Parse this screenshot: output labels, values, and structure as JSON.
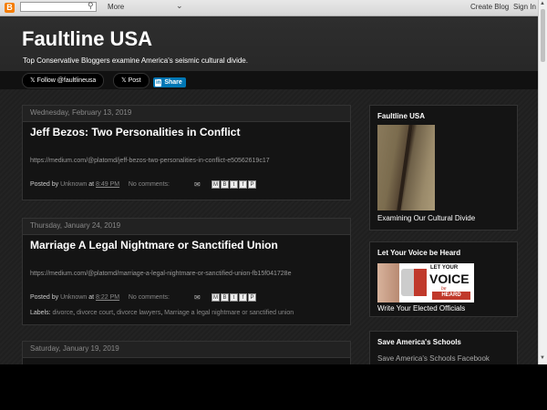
{
  "navbar": {
    "logo_letter": "B",
    "search_icon": "search-icon",
    "more_label": "More",
    "create_blog": "Create Blog",
    "sign_in": "Sign In"
  },
  "header": {
    "title": "Faultline USA",
    "description": "Top Conservative Bloggers examine America's seismic cultural divide.",
    "follow_label": "Follow @faultlineusa",
    "post_label": "Post",
    "share_label": "Share",
    "linkedin_mark": "in"
  },
  "posts": [
    {
      "date": "Wednesday, February 13, 2019",
      "title": "Jeff Bezos: Two Personalities in Conflict",
      "url": "https://medium.com/@platomd/jeff-bezos-two-personalities-in-conflict-e50562619c17",
      "posted_by_label": "Posted by",
      "author": "Unknown",
      "at_label": "at",
      "time": "8:49 PM",
      "comments": "No comments:"
    },
    {
      "date": "Thursday, January 24, 2019",
      "title": "Marriage A Legal Nightmare or Sanctified Union",
      "url": "https://medium.com/@platomd/marriage-a-legal-nightmare-or-sanctified-union-fb15f041728e",
      "posted_by_label": "Posted by",
      "author": "Unknown",
      "at_label": "at",
      "time": "8:22 PM",
      "comments": "No comments:",
      "labels_label": "Labels:",
      "labels": [
        "divorce",
        "divorce court",
        "divorce lawyers",
        "Marriage a legal nightmare or sanctified union"
      ]
    },
    {
      "date": "Saturday, January 19, 2019"
    }
  ],
  "sidebar": {
    "widget1": {
      "title": "Faultline USA",
      "caption": "Examining Our Cultural Divide"
    },
    "widget2": {
      "title": "Let Your Voice be Heard",
      "caption": "Write Your Elected Officials",
      "image_text": {
        "line1": "LET YOUR",
        "line2": "VOICE",
        "line3": "be",
        "line4": "HEARD"
      }
    },
    "widget3": {
      "title": "Save America's Schools",
      "link": "Save America's Schools Facebook"
    }
  },
  "icons": {
    "mail": "mail-icon",
    "share_buttons": [
      "M",
      "B",
      "t",
      "f",
      "P"
    ]
  }
}
